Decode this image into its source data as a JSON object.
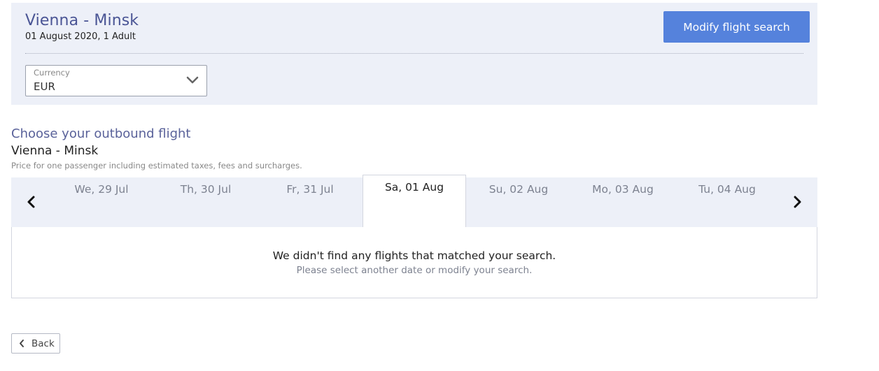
{
  "summary": {
    "route": "Vienna - Minsk",
    "details": "01 August 2020, 1 Adult",
    "modify_label": "Modify flight search",
    "currency": {
      "label": "Currency",
      "value": "EUR",
      "icon": "chevron-down-icon"
    }
  },
  "outbound": {
    "title": "Choose your outbound flight",
    "route": "Vienna - Minsk",
    "price_note": "Price for one passenger including estimated taxes, fees and surcharges."
  },
  "dates": {
    "prev_icon": "chevron-left-icon",
    "next_icon": "chevron-right-icon",
    "items": [
      {
        "label": "We, 29 Jul",
        "active": false
      },
      {
        "label": "Th, 30 Jul",
        "active": false
      },
      {
        "label": "Fr, 31 Jul",
        "active": false
      },
      {
        "label": "Sa, 01 Aug",
        "active": true
      },
      {
        "label": "Su, 02 Aug",
        "active": false
      },
      {
        "label": "Mo, 03 Aug",
        "active": false
      },
      {
        "label": "Tu, 04 Aug",
        "active": false
      }
    ]
  },
  "results": {
    "message": "We didn't find any flights that matched your search.",
    "hint": "Please select another date or modify your search."
  },
  "back": {
    "label": "Back",
    "icon": "chevron-left-icon"
  },
  "colors": {
    "panel_bg": "#edf0f8",
    "title_blue": "#4a5595",
    "button_blue": "#5582dc"
  }
}
